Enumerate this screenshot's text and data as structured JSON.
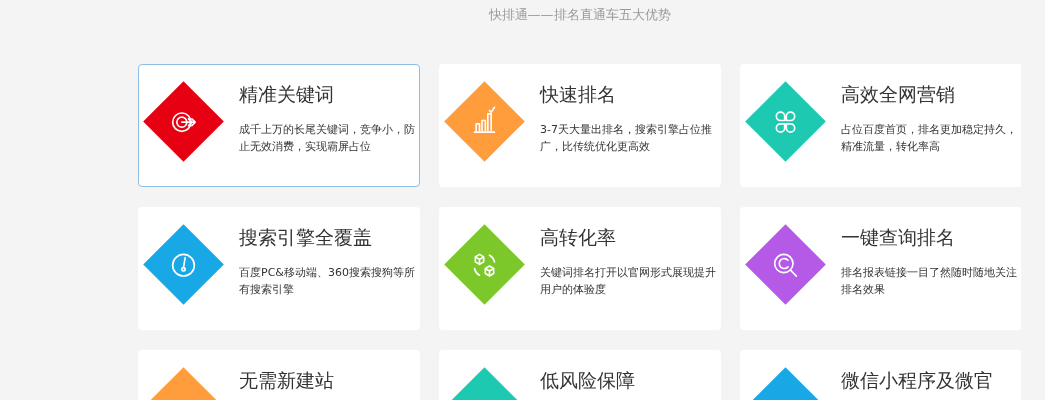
{
  "heading": "快排通——排名直通车五大优势",
  "cards": [
    {
      "title": "精准关键词",
      "description": "成千上万的长尾关键词，竞争小，防止无效消费，实现霸屏占位",
      "kind": "target",
      "color": "#e60012",
      "selected": true
    },
    {
      "title": "快速排名",
      "description": "3-7天大量出排名，搜索引擎占位推广，比传统优化更高效",
      "kind": "chart",
      "color": "#ff9d3d",
      "selected": false
    },
    {
      "title": "高效全网营销",
      "description": "占位百度首页，排名更加稳定持久，精准流量，转化率高",
      "kind": "clover",
      "color": "#1dc9b0",
      "selected": false
    },
    {
      "title": "搜索引擎全覆盖",
      "description": "百度PC&移动端、360搜索搜狗等所有搜索引擎",
      "kind": "gauge",
      "color": "#18a8e6",
      "selected": false
    },
    {
      "title": "高转化率",
      "description": "关键词排名打开以官网形式展现提升用户的体验度",
      "kind": "cubes",
      "color": "#7cc72a",
      "selected": false
    },
    {
      "title": "一键查询排名",
      "description": "排名报表链接一目了然随时随地关注排名效果",
      "kind": "search",
      "color": "#b45ae6",
      "selected": false
    },
    {
      "title": "无需新建站",
      "kind": "plain",
      "color": "#ff9d3d",
      "selected": false
    },
    {
      "title": "低风险保障",
      "kind": "plain",
      "color": "#1dc9b0",
      "selected": false
    },
    {
      "title": "微信小程序及微官",
      "kind": "plain",
      "color": "#18a8e6",
      "selected": false
    }
  ]
}
